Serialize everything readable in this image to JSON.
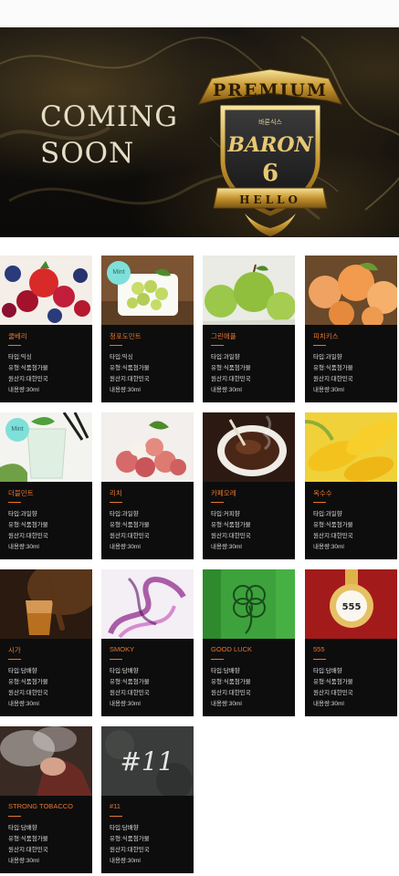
{
  "banner": {
    "coming_line1": "COMING",
    "coming_line2": "SOON",
    "badge_top": "PREMIUM",
    "badge_korean": "바론식스",
    "badge_brand": "BARON",
    "badge_number": "6",
    "badge_ribbon": "HELLO"
  },
  "labels": {
    "type": "타입",
    "kind": "유형",
    "origin": "원산지",
    "volume": "내용량"
  },
  "badges": {
    "mint": "Mint"
  },
  "products": [
    {
      "name": "쿨베리",
      "type": "믹싱",
      "kind": "식품첨가물",
      "origin": "대한민국",
      "volume": "30ml",
      "image": "berries",
      "mint": false
    },
    {
      "name": "청포도민트",
      "type": "믹싱",
      "kind": "식품첨가물",
      "origin": "대한민국",
      "volume": "30ml",
      "image": "green-grapes",
      "mint": true
    },
    {
      "name": "그린애플",
      "type": "과일향",
      "kind": "식품첨가물",
      "origin": "대한민국",
      "volume": "30ml",
      "image": "green-apples",
      "mint": false
    },
    {
      "name": "피치키스",
      "type": "과일향",
      "kind": "식품첨가물",
      "origin": "대한민국",
      "volume": "30ml",
      "image": "peaches",
      "mint": false
    },
    {
      "name": "더블민트",
      "type": "과일향",
      "kind": "식품첨가물",
      "origin": "대한민국",
      "volume": "30ml",
      "image": "mint-drink",
      "mint": true
    },
    {
      "name": "리치",
      "type": "과일향",
      "kind": "식품첨가물",
      "origin": "대한민국",
      "volume": "30ml",
      "image": "lychee",
      "mint": false
    },
    {
      "name": "카페오레",
      "type": "커피향",
      "kind": "식품첨가물",
      "origin": "대한민국",
      "volume": "30ml",
      "image": "coffee",
      "mint": false
    },
    {
      "name": "옥수수",
      "type": "과일향",
      "kind": "식품첨가물",
      "origin": "대한민국",
      "volume": "30ml",
      "image": "corn",
      "mint": false
    },
    {
      "name": "시가",
      "type": "담배향",
      "kind": "식품첨가물",
      "origin": "대한민국",
      "volume": "30ml",
      "image": "cigar-whiskey",
      "mint": false
    },
    {
      "name": "SMOKY",
      "type": "담배향",
      "kind": "식품첨가물",
      "origin": "대한민국",
      "volume": "30ml",
      "image": "purple-smoke",
      "mint": false
    },
    {
      "name": "GOOD LUCK",
      "type": "담배향",
      "kind": "식품첨가물",
      "origin": "대한민국",
      "volume": "30ml",
      "image": "clover",
      "mint": false
    },
    {
      "name": "555",
      "type": "담배향",
      "kind": "식품첨가물",
      "origin": "대한민국",
      "volume": "30ml",
      "image": "555-emblem",
      "mint": false
    },
    {
      "name": "STRONG TOBACCO",
      "type": "담배향",
      "kind": "식품첨가물",
      "origin": "대한민국",
      "volume": "30ml",
      "image": "smoker",
      "mint": false
    },
    {
      "name": "#11",
      "type": "담배향",
      "kind": "식품첨가물",
      "origin": "대한민국",
      "volume": "30ml",
      "image": "chalk-11",
      "mint": false
    }
  ]
}
